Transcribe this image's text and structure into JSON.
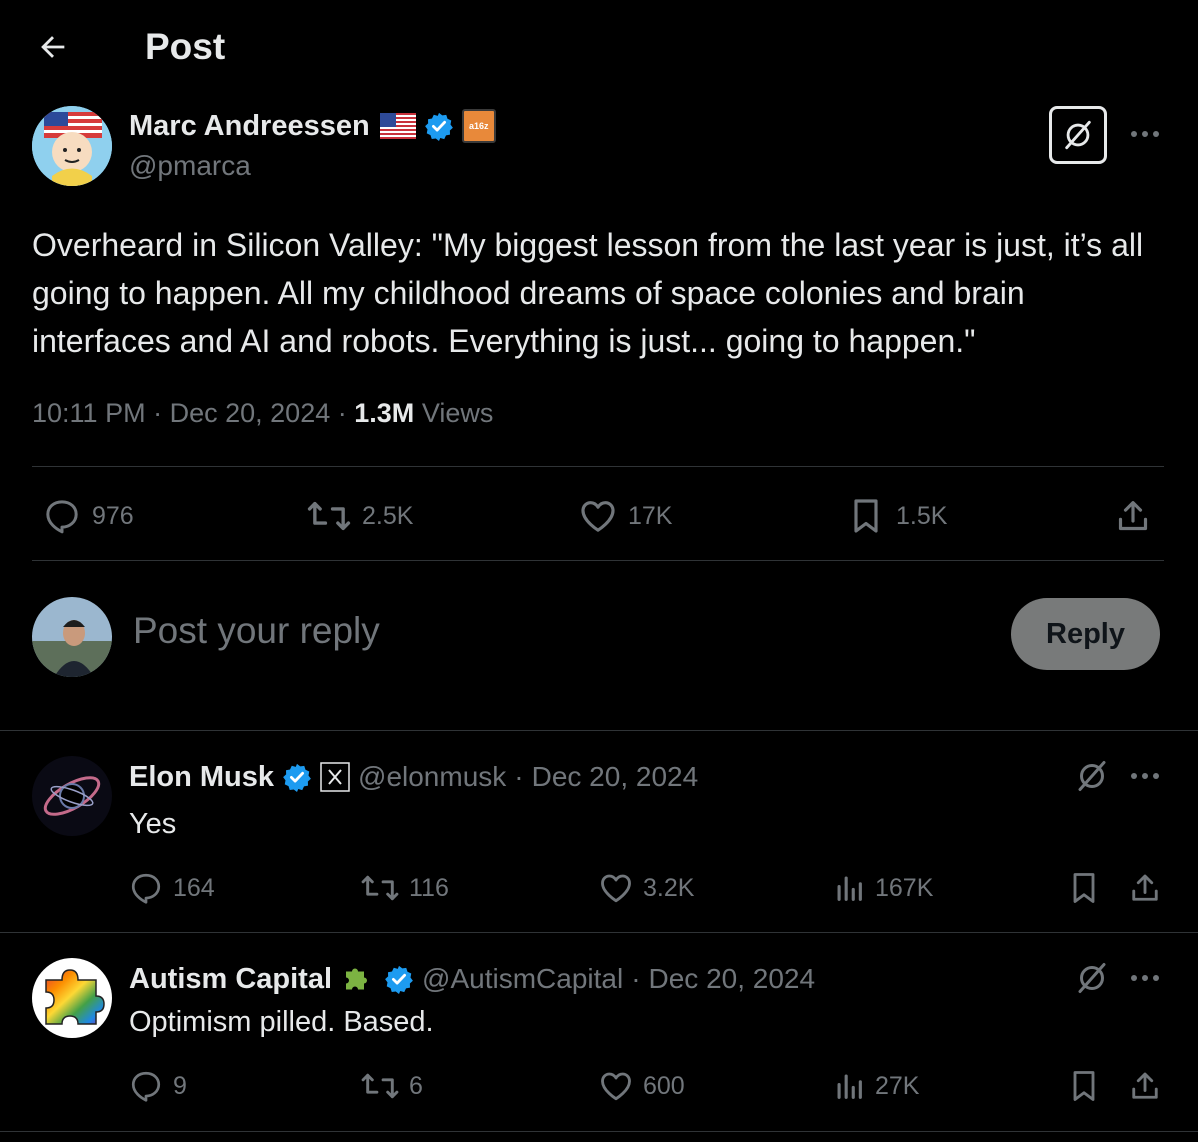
{
  "header": {
    "title": "Post"
  },
  "post": {
    "author_name": "Marc Andreessen",
    "handle": "@pmarca",
    "affiliate_badge": "a16z",
    "text": "Overheard in Silicon Valley: \"My biggest lesson from the last year is just, it’s all going to happen. All my childhood dreams of space colonies and brain interfaces and AI and robots. Everything is just... going to happen.\"",
    "time": "10:11 PM",
    "date": "Dec 20, 2024",
    "views_count": "1.3M",
    "views_label": "Views",
    "sep": "·",
    "stats": {
      "replies": "976",
      "reposts": "2.5K",
      "likes": "17K",
      "bookmarks": "1.5K"
    }
  },
  "composer": {
    "placeholder": "Post your reply",
    "button": "Reply"
  },
  "replies": [
    {
      "name": "Elon Musk",
      "handle": "@elonmusk",
      "date": "Dec 20, 2024",
      "text": "Yes",
      "stats": {
        "replies": "164",
        "reposts": "116",
        "likes": "3.2K",
        "views": "167K"
      }
    },
    {
      "name": "Autism Capital",
      "handle": "@AutismCapital",
      "date": "Dec 20, 2024",
      "text": "Optimism pilled. Based.",
      "stats": {
        "replies": "9",
        "reposts": "6",
        "likes": "600",
        "views": "27K"
      }
    }
  ],
  "colors": {
    "background": "#000000",
    "text": "#e7e9ea",
    "muted": "#71767b",
    "divider": "#2f3336",
    "verified": "#1d9bf0",
    "reply_button": "#787a7a"
  },
  "icons": [
    "back-arrow-icon",
    "verified-icon",
    "us-flag-icon",
    "grok-icon",
    "more-icon",
    "reply-icon",
    "repost-icon",
    "like-icon",
    "bookmark-icon",
    "share-icon",
    "views-icon",
    "x-logo-icon",
    "puzzle-icon"
  ]
}
